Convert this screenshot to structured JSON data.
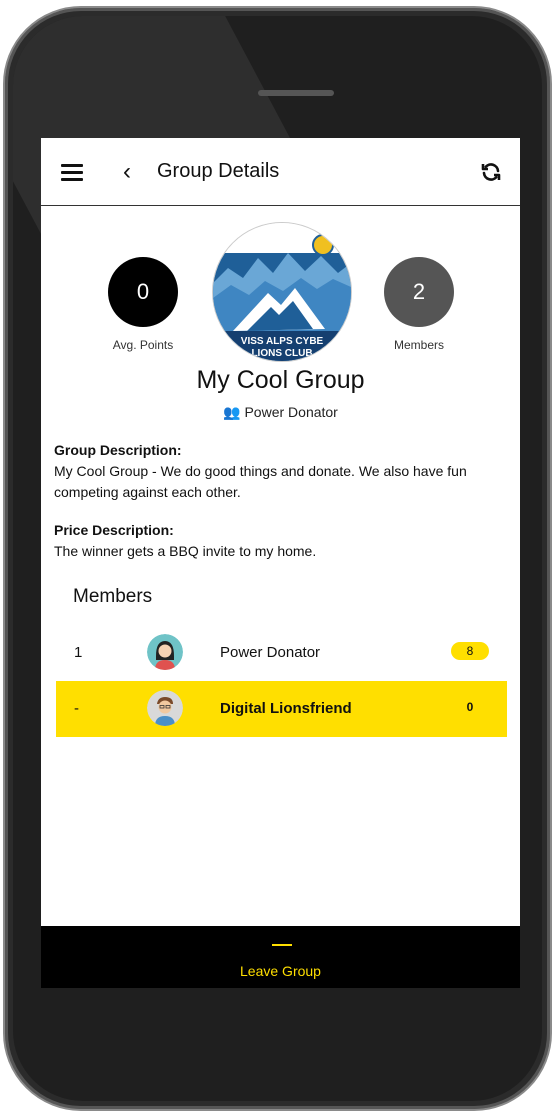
{
  "header": {
    "title": "Group Details"
  },
  "stats": {
    "avg_points_value": "0",
    "avg_points_label": "Avg. Points",
    "members_value": "2",
    "members_label": "Members"
  },
  "group": {
    "logo_text_line1": "VISS ALPS CYBE",
    "logo_text_line2": "LIONS CLUB",
    "name": "My Cool Group",
    "owner": "Power Donator",
    "description_heading": "Group Description:",
    "description": "My Cool Group - We do good things and donate. We also have fun competing against each other.",
    "price_heading": "Price Description:",
    "price": "The winner gets a BBQ invite to my home."
  },
  "members": {
    "title": "Members",
    "rows": [
      {
        "rank": "1",
        "name": "Power Donator",
        "score": "8"
      },
      {
        "rank": "-",
        "name": "Digital Lionsfriend",
        "score": "0"
      }
    ]
  },
  "footer": {
    "button_label": "Leave Group"
  },
  "colors": {
    "accent": "#ffdf00",
    "dark": "#000000",
    "gray": "#555555"
  }
}
